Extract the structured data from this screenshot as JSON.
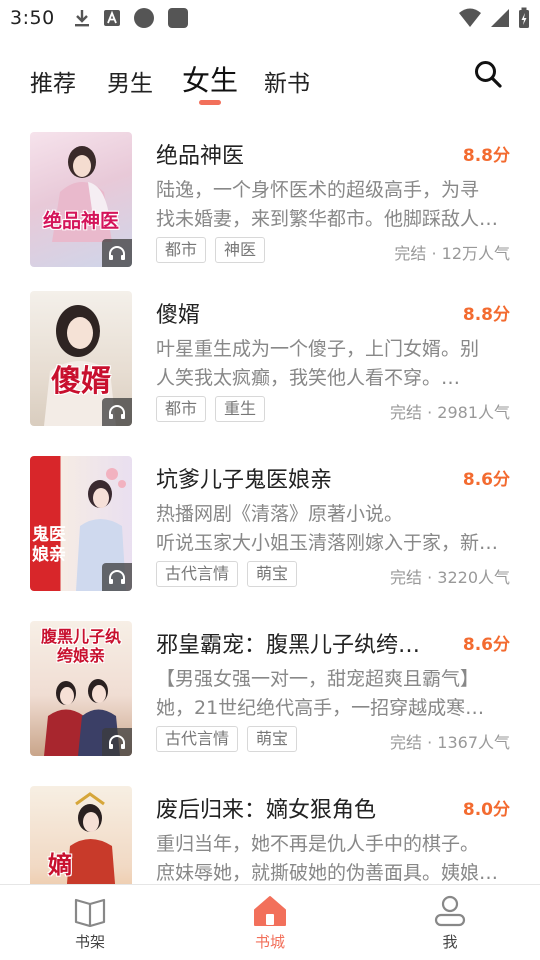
{
  "status_bar": {
    "time": "3:50",
    "left_icons": [
      "download-icon",
      "a-box-icon",
      "circle-icon",
      "square-icon"
    ],
    "right_icons": [
      "wifi-icon",
      "signal-icon",
      "battery-charging-icon"
    ]
  },
  "top_nav": {
    "tabs": [
      {
        "label": "推荐",
        "active": false
      },
      {
        "label": "男生",
        "active": false
      },
      {
        "label": "女生",
        "active": true
      },
      {
        "label": "新书",
        "active": false
      }
    ],
    "accent_color": "#f2705b",
    "search_icon": "search-icon"
  },
  "books": [
    {
      "title": "绝品神医",
      "score": "8.8分",
      "desc_line1": "陆逸，一个身怀医术的超级高手，为寻",
      "desc_line2": "找未婚妻，来到繁华都市。他脚踩敌人…",
      "tags": [
        "都市",
        "神医"
      ],
      "meta": "完结 · 12万人气",
      "cover_text": "绝品神医"
    },
    {
      "title": "傻婿",
      "score": "8.8分",
      "desc_line1": "叶星重生成为一个傻子，上门女婿。别",
      "desc_line2": "人笑我太疯癫，我笑他人看不穿。…",
      "tags": [
        "都市",
        "重生"
      ],
      "meta": "完结 · 2981人气",
      "cover_text": "傻婿"
    },
    {
      "title": "坑爹儿子鬼医娘亲",
      "score": "8.6分",
      "desc_line1": "热播网剧《清落》原著小说。",
      "desc_line2": "听说玉家大小姐玉清落刚嫁入于家，新…",
      "tags": [
        "古代言情",
        "萌宝"
      ],
      "meta": "完结 · 3220人气",
      "cover_text": "鬼医娘亲"
    },
    {
      "title": "邪皇霸宠：腹黑儿子纨绔…",
      "score": "8.6分",
      "desc_line1": "【男强女强一对一，甜宠超爽且霸气】",
      "desc_line2": "她，21世纪绝代高手，一招穿越成寒…",
      "tags": [
        "古代言情",
        "萌宝"
      ],
      "meta": "完结 · 1367人气",
      "cover_text": "腹黑儿子纨绔娘亲"
    },
    {
      "title": "废后归来：嫡女狠角色",
      "score": "8.0分",
      "desc_line1": "重归当年，她不再是仇人手中的棋子。",
      "desc_line2": "庶妹辱她，就撕破她的伪善面具。姨娘…",
      "tags": [],
      "meta": "",
      "cover_text": "嫡女"
    }
  ],
  "bottom_nav": {
    "items": [
      {
        "label": "书架",
        "icon": "book-icon",
        "active": false
      },
      {
        "label": "书城",
        "icon": "home-icon",
        "active": true
      },
      {
        "label": "我",
        "icon": "user-icon",
        "active": false
      }
    ]
  }
}
